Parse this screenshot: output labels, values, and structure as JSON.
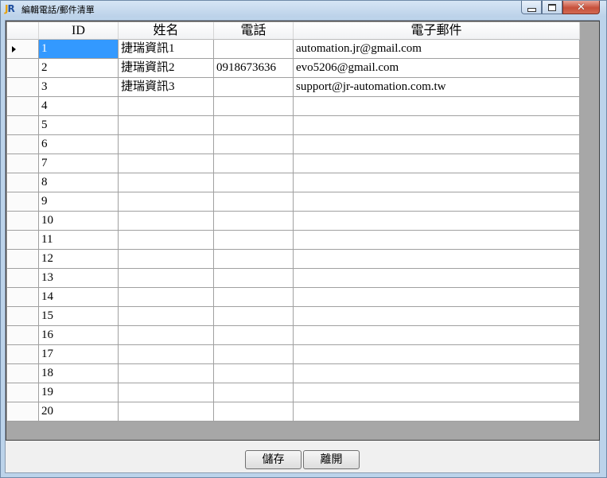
{
  "window": {
    "title": "編輯電話/郵件清單",
    "icon_text_j": "J",
    "icon_text_r": "R",
    "close_glyph": "✕"
  },
  "grid": {
    "columns": [
      "ID",
      "姓名",
      "電話",
      "電子郵件"
    ],
    "current_row": 1,
    "rows": [
      {
        "id": "1",
        "name": "捷瑞資訊1",
        "phone": "",
        "email": "automation.jr@gmail.com"
      },
      {
        "id": "2",
        "name": "捷瑞資訊2",
        "phone": "0918673636",
        "email": "evo5206@gmail.com"
      },
      {
        "id": "3",
        "name": "捷瑞資訊3",
        "phone": "",
        "email": "support@jr-automation.com.tw"
      },
      {
        "id": "4",
        "name": "",
        "phone": "",
        "email": ""
      },
      {
        "id": "5",
        "name": "",
        "phone": "",
        "email": ""
      },
      {
        "id": "6",
        "name": "",
        "phone": "",
        "email": ""
      },
      {
        "id": "7",
        "name": "",
        "phone": "",
        "email": ""
      },
      {
        "id": "8",
        "name": "",
        "phone": "",
        "email": ""
      },
      {
        "id": "9",
        "name": "",
        "phone": "",
        "email": ""
      },
      {
        "id": "10",
        "name": "",
        "phone": "",
        "email": ""
      },
      {
        "id": "11",
        "name": "",
        "phone": "",
        "email": ""
      },
      {
        "id": "12",
        "name": "",
        "phone": "",
        "email": ""
      },
      {
        "id": "13",
        "name": "",
        "phone": "",
        "email": ""
      },
      {
        "id": "14",
        "name": "",
        "phone": "",
        "email": ""
      },
      {
        "id": "15",
        "name": "",
        "phone": "",
        "email": ""
      },
      {
        "id": "16",
        "name": "",
        "phone": "",
        "email": ""
      },
      {
        "id": "17",
        "name": "",
        "phone": "",
        "email": ""
      },
      {
        "id": "18",
        "name": "",
        "phone": "",
        "email": ""
      },
      {
        "id": "19",
        "name": "",
        "phone": "",
        "email": ""
      },
      {
        "id": "20",
        "name": "",
        "phone": "",
        "email": ""
      }
    ]
  },
  "buttons": {
    "save_label": "儲存",
    "exit_label": "離開"
  },
  "colors": {
    "selection": "#3399ff",
    "grid_background": "#a7a7a7"
  }
}
